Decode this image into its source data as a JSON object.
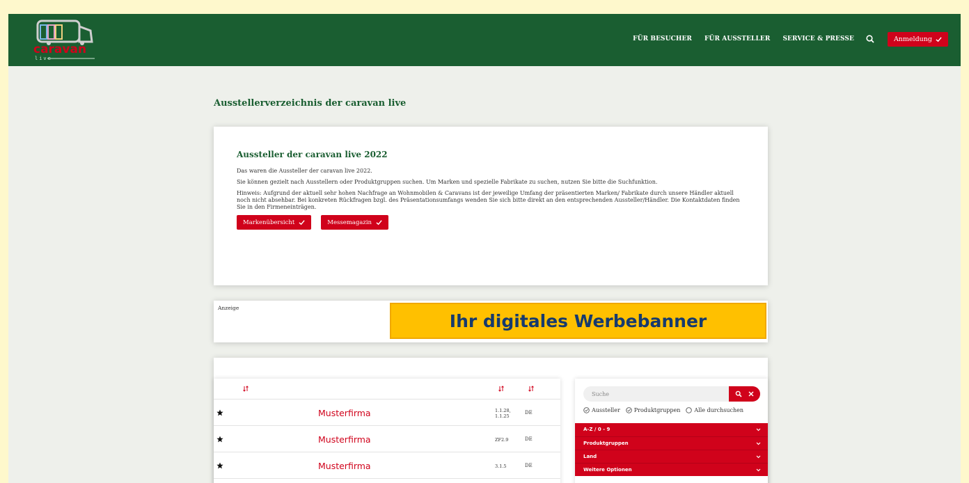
{
  "brand": {
    "logo_text": "caravan",
    "logo_sub": "live"
  },
  "nav": {
    "items": [
      "FÜR BESUCHER",
      "FÜR AUSSTELLER",
      "SERVICE & PRESSE"
    ],
    "search_icon": "search-icon",
    "login_label": "Anmeldung"
  },
  "page": {
    "title": "Ausstellerverzeichnis der caravan live"
  },
  "intro": {
    "heading": "Aussteller der caravan live 2022",
    "p1": "Das waren die Aussteller der caravan live 2022.",
    "p2": "Sie können gezielt nach Ausstellern oder Produktgruppen suchen. Um Marken und spezielle Fabrikate zu suchen, nutzen Sie bitte die Suchfunktion.",
    "p3": "Hinweis: Aufgrund der aktuell sehr hohen Nachfrage an Wohnmobilen & Caravans ist der jeweilige Umfang der präsentierten Marken/ Fabrikate durch unsere Händler aktuell noch nicht absehbar. Bei konkreten Rückfragen bzgl. des Präsentationsumfangs wenden Sie sich bitte direkt an den entsprechenden Aussteller/Händler. Die Kontaktdaten finden Sie in den Firmeneinträgen.",
    "btn_brands": "Markenübersicht",
    "btn_magazine": "Messemagazin"
  },
  "ad": {
    "label": "Anzeige",
    "banner_text": "Ihr digitales Werbebanner"
  },
  "table": {
    "rows": [
      {
        "name": "Musterfirma",
        "hall_1": "1.1.28,",
        "hall_2": "1.1.25",
        "country": "DE"
      },
      {
        "name": "Musterfirma",
        "hall_1": "ZF2.9",
        "hall_2": "",
        "country": "DE"
      },
      {
        "name": "Musterfirma",
        "hall_1": "3.1.5",
        "hall_2": "",
        "country": "DE"
      }
    ]
  },
  "sidebar": {
    "search_placeholder": "Suche",
    "radios": [
      "Aussteller",
      "Produktgruppen",
      "Alle durchsuchen"
    ],
    "accordions": [
      "A-Z / 0 - 9",
      "Produktgruppen",
      "Land",
      "Weitere Optionen"
    ]
  },
  "colors": {
    "brand_green": "#1a5e31",
    "accent_red": "#d0021b",
    "banner_yellow": "#ffc000",
    "banner_text": "#163a6e"
  }
}
